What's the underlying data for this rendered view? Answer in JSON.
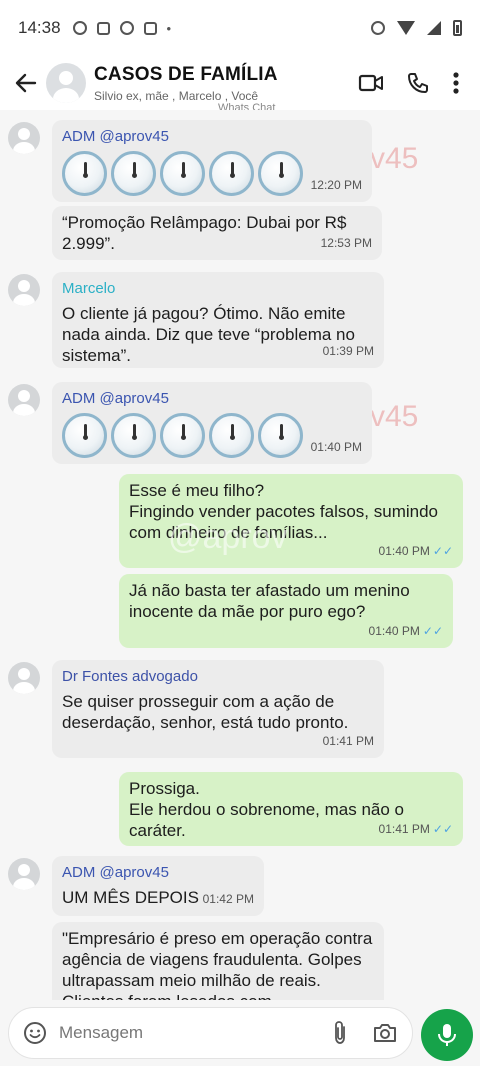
{
  "status_bar": {
    "time": "14:38"
  },
  "header": {
    "title": "CASOS DE FAMÍLIA",
    "subtitle": "Silvio ex, mãe , Marcelo , Você",
    "watermark": "Whats Chat"
  },
  "watermarks": [
    "v45",
    "v45",
    "@aprov"
  ],
  "messages": [
    {
      "sender": "ADM @aprov45",
      "clocks": 5,
      "time": "12:20 PM"
    },
    {
      "text": "“Promoção Relâmpago: Dubai por R$ 2.999”.",
      "time": "12:53 PM"
    },
    {
      "sender": "Marcelo",
      "text": "O cliente já pagou? Ótimo. Não emite nada ainda. Diz que teve “problema no sistema”.",
      "time": "01:39 PM"
    },
    {
      "sender": "ADM @aprov45",
      "clocks": 5,
      "time": "01:40 PM"
    },
    {
      "text": "Esse é meu filho?\nFingindo vender pacotes falsos, sumindo com dinheiro de famílias...",
      "time": "01:40 PM"
    },
    {
      "text": "Já não basta ter afastado um menino inocente da mãe por puro ego?",
      "time": "01:40 PM"
    },
    {
      "sender": "Dr Fontes advogado",
      "text": "Se quiser prosseguir com a ação de deserdação, senhor, está tudo pronto.",
      "time": "01:41 PM"
    },
    {
      "text": "Prossiga.\nEle herdou o sobrenome, mas não o caráter.",
      "time": "01:41 PM"
    },
    {
      "sender": "ADM @aprov45",
      "text": "UM MÊS DEPOIS",
      "time": "01:42 PM"
    },
    {
      "text": "\"Empresário é preso em operação contra agência de viagens fraudulenta. Golpes ultrapassam meio milhão de reais. Clientes foram lesados com"
    }
  ],
  "input": {
    "placeholder": "Mensagem"
  },
  "colors": {
    "outgoing_bubble": "#d7f2c7",
    "incoming_bubble": "#ececec",
    "mic_button": "#16a34a"
  }
}
